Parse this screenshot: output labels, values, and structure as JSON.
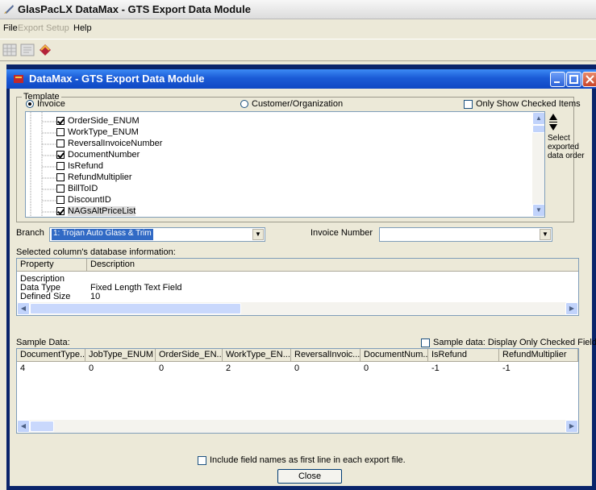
{
  "app": {
    "title": "GlasPacLX  DataMax - GTS Export Data Module"
  },
  "menu": {
    "file": "File",
    "export": "Export",
    "setup": "Setup",
    "help": "Help"
  },
  "child": {
    "title": "DataMax - GTS Export Data Module"
  },
  "template": {
    "legend": "Template",
    "invoice_label": "Invoice",
    "customer_label": "Customer/Organization",
    "only_checked_label": "Only Show Checked Items",
    "fields": [
      {
        "name": "OrderSide_ENUM",
        "checked": true
      },
      {
        "name": "WorkType_ENUM",
        "checked": false
      },
      {
        "name": "ReversalInvoiceNumber",
        "checked": false
      },
      {
        "name": "DocumentNumber",
        "checked": true
      },
      {
        "name": "IsRefund",
        "checked": false
      },
      {
        "name": "RefundMultiplier",
        "checked": false
      },
      {
        "name": "BillToID",
        "checked": false
      },
      {
        "name": "DiscountID",
        "checked": false
      },
      {
        "name": "NAGsAltPriceList",
        "checked": true
      }
    ],
    "order_note": [
      "Select",
      "exported",
      "data order"
    ]
  },
  "branch": {
    "label": "Branch",
    "value": "1: Trojan Auto Glass & Trim"
  },
  "invoice_number": {
    "label": "Invoice Number",
    "value": ""
  },
  "column_info": {
    "title": "Selected column's database information:",
    "headers": [
      "Property",
      "Description"
    ],
    "rows": [
      {
        "property": "Description",
        "description": ""
      },
      {
        "property": "Data Type",
        "description": "Fixed Length Text Field"
      },
      {
        "property": "Defined Size",
        "description": "10"
      }
    ]
  },
  "sample": {
    "title": "Sample Data:",
    "only_checked_label": "Sample data: Display Only Checked Fields",
    "headers": [
      "DocumentType...",
      "JobType_ENUM",
      "OrderSide_EN...",
      "WorkType_EN...",
      "ReversalInvoic...",
      "DocumentNum...",
      "IsRefund",
      "RefundMultiplier"
    ],
    "rows": [
      [
        "4",
        "0",
        "0",
        "2",
        "0",
        "0",
        "-1",
        "-1"
      ]
    ]
  },
  "footer": {
    "include_names_label": "Include field names as first line in each export file.",
    "close_label": "Close"
  },
  "colors": {
    "title_blue": "#1b5bd6",
    "selection": "#316ac5"
  },
  "icons": [
    "app-icon",
    "toolbar-grid-icon",
    "toolbar-export-icon",
    "toolbar-book-icon",
    "datamax-icon",
    "minimize-icon",
    "maximize-icon",
    "close-icon",
    "arrow-up-icon",
    "arrow-down-icon"
  ]
}
